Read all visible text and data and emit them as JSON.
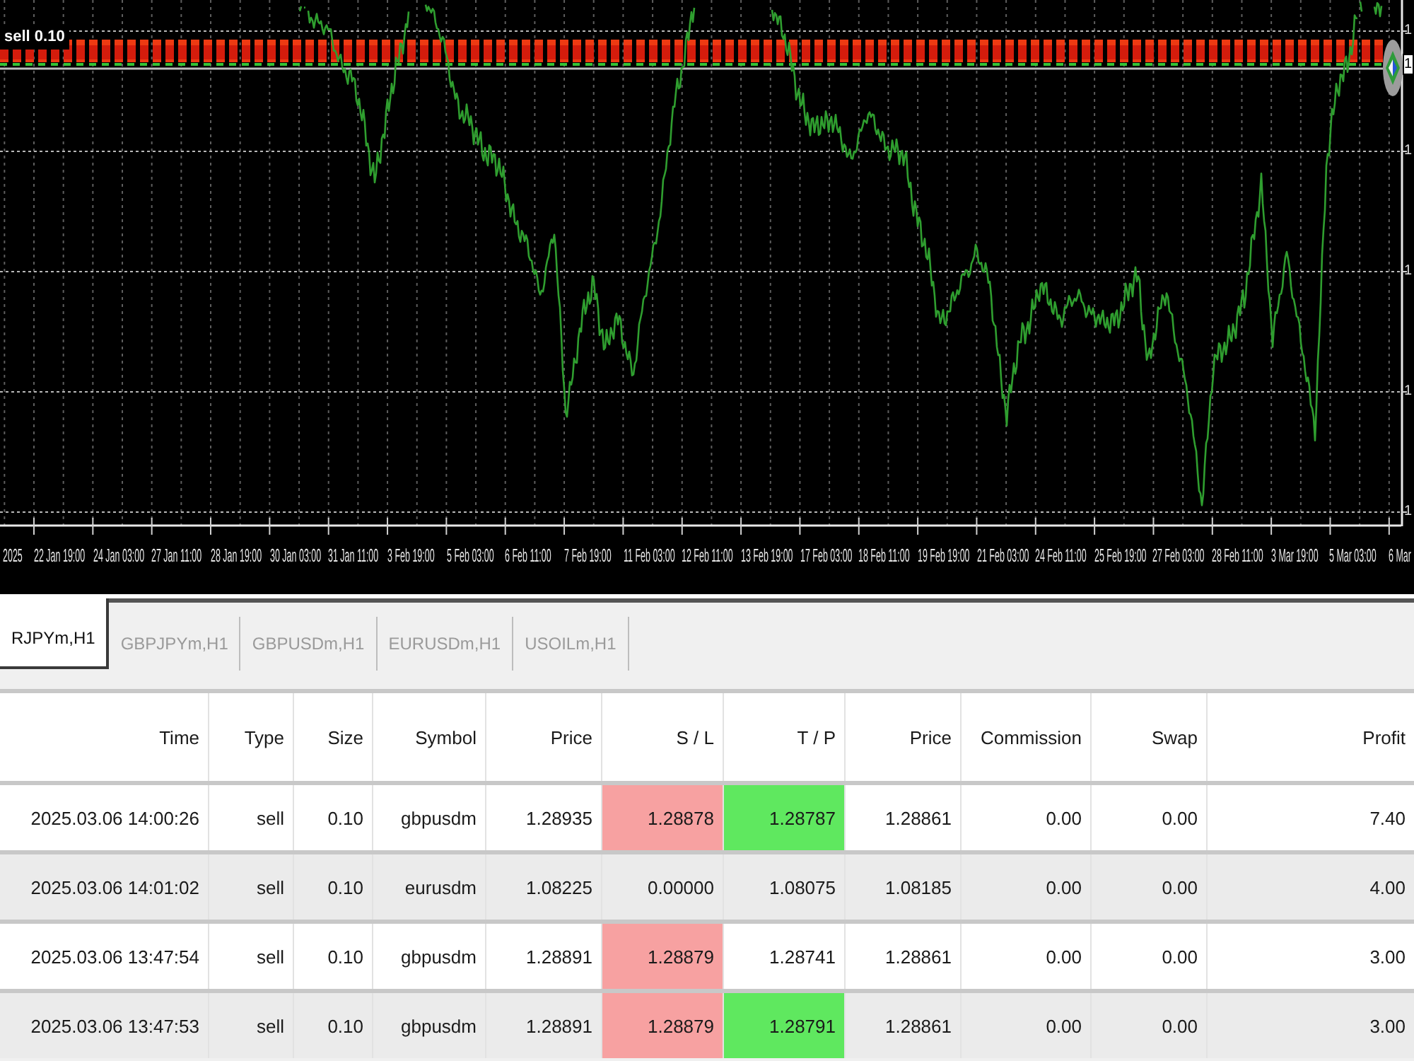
{
  "chart": {
    "order_tag": "sell 0.10",
    "price_axis": [
      {
        "label": "1",
        "kind": "tick"
      },
      {
        "label": "1",
        "kind": "current"
      },
      {
        "label": "1",
        "kind": "tick"
      },
      {
        "label": "1",
        "kind": "tick"
      },
      {
        "label": "1",
        "kind": "tick"
      },
      {
        "label": "1",
        "kind": "tick"
      }
    ],
    "time_axis": [
      "2025",
      "22 Jan 19:00",
      "24 Jan 03:00",
      "27 Jan 11:00",
      "28 Jan 19:00",
      "30 Jan 03:00",
      "31 Jan 11:00",
      "3 Feb 19:00",
      "5 Feb 03:00",
      "6 Feb 11:00",
      "7 Feb 19:00",
      "11 Feb 03:00",
      "12 Feb 11:00",
      "13 Feb 19:00",
      "17 Feb 03:00",
      "18 Feb 11:00",
      "19 Feb 19:00",
      "21 Feb 03:00",
      "24 Feb 11:00",
      "25 Feb 19:00",
      "27 Feb 03:00",
      "28 Feb 11:00",
      "3 Mar 19:00",
      "5 Mar 03:00",
      "6 Mar"
    ]
  },
  "chart_tabs": [
    {
      "label": "RJPYm,H1",
      "selected": true
    },
    {
      "label": "GBPJPYm,H1",
      "selected": false
    },
    {
      "label": "GBPUSDm,H1",
      "selected": false
    },
    {
      "label": "EURUSDm,H1",
      "selected": false
    },
    {
      "label": "USOILm,H1",
      "selected": false
    }
  ],
  "trade_table": {
    "columns": [
      {
        "label": "Time"
      },
      {
        "label": "Type"
      },
      {
        "label": "Size"
      },
      {
        "label": "Symbol"
      },
      {
        "label": "Price"
      },
      {
        "label": "S / L",
        "kind": "stop_loss"
      },
      {
        "label": "T / P",
        "kind": "take_profit"
      },
      {
        "label": "Price"
      },
      {
        "label": "Commission"
      },
      {
        "label": "Swap"
      },
      {
        "label": "Profit"
      }
    ],
    "rows": [
      {
        "cells": [
          {
            "text": "2025.03.06 14:00:26",
            "highlighted": false
          },
          {
            "text": "sell",
            "highlighted": false
          },
          {
            "text": "0.10",
            "highlighted": false
          },
          {
            "text": "gbpusdm",
            "highlighted": false
          },
          {
            "text": "1.28935",
            "highlighted": false
          },
          {
            "text": "1.28878",
            "highlighted": true
          },
          {
            "text": "1.28787",
            "highlighted": true
          },
          {
            "text": "1.28861",
            "highlighted": false
          },
          {
            "text": "0.00",
            "highlighted": false
          },
          {
            "text": "0.00",
            "highlighted": false
          },
          {
            "text": "7.40",
            "highlighted": false
          }
        ]
      },
      {
        "cells": [
          {
            "text": "2025.03.06 14:01:02",
            "highlighted": false
          },
          {
            "text": "sell",
            "highlighted": false
          },
          {
            "text": "0.10",
            "highlighted": false
          },
          {
            "text": "eurusdm",
            "highlighted": false
          },
          {
            "text": "1.08225",
            "highlighted": false
          },
          {
            "text": "0.00000",
            "highlighted": false
          },
          {
            "text": "1.08075",
            "highlighted": false
          },
          {
            "text": "1.08185",
            "highlighted": false
          },
          {
            "text": "0.00",
            "highlighted": false
          },
          {
            "text": "0.00",
            "highlighted": false
          },
          {
            "text": "4.00",
            "highlighted": false
          }
        ]
      },
      {
        "cells": [
          {
            "text": "2025.03.06 13:47:54",
            "highlighted": false
          },
          {
            "text": "sell",
            "highlighted": false
          },
          {
            "text": "0.10",
            "highlighted": false
          },
          {
            "text": "gbpusdm",
            "highlighted": false
          },
          {
            "text": "1.28891",
            "highlighted": false
          },
          {
            "text": "1.28879",
            "highlighted": true
          },
          {
            "text": "1.28741",
            "highlighted": false
          },
          {
            "text": "1.28861",
            "highlighted": false
          },
          {
            "text": "0.00",
            "highlighted": false
          },
          {
            "text": "0.00",
            "highlighted": false
          },
          {
            "text": "3.00",
            "highlighted": false
          }
        ]
      },
      {
        "cells": [
          {
            "text": "2025.03.06 13:47:53",
            "highlighted": false
          },
          {
            "text": "sell",
            "highlighted": false
          },
          {
            "text": "0.10",
            "highlighted": false
          },
          {
            "text": "gbpusdm",
            "highlighted": false
          },
          {
            "text": "1.28891",
            "highlighted": false
          },
          {
            "text": "1.28879",
            "highlighted": true
          },
          {
            "text": "1.28791",
            "highlighted": true
          },
          {
            "text": "1.28861",
            "highlighted": false
          },
          {
            "text": "0.00",
            "highlighted": false
          },
          {
            "text": "0.00",
            "highlighted": false
          },
          {
            "text": "3.00",
            "highlighted": false
          }
        ]
      }
    ]
  }
}
